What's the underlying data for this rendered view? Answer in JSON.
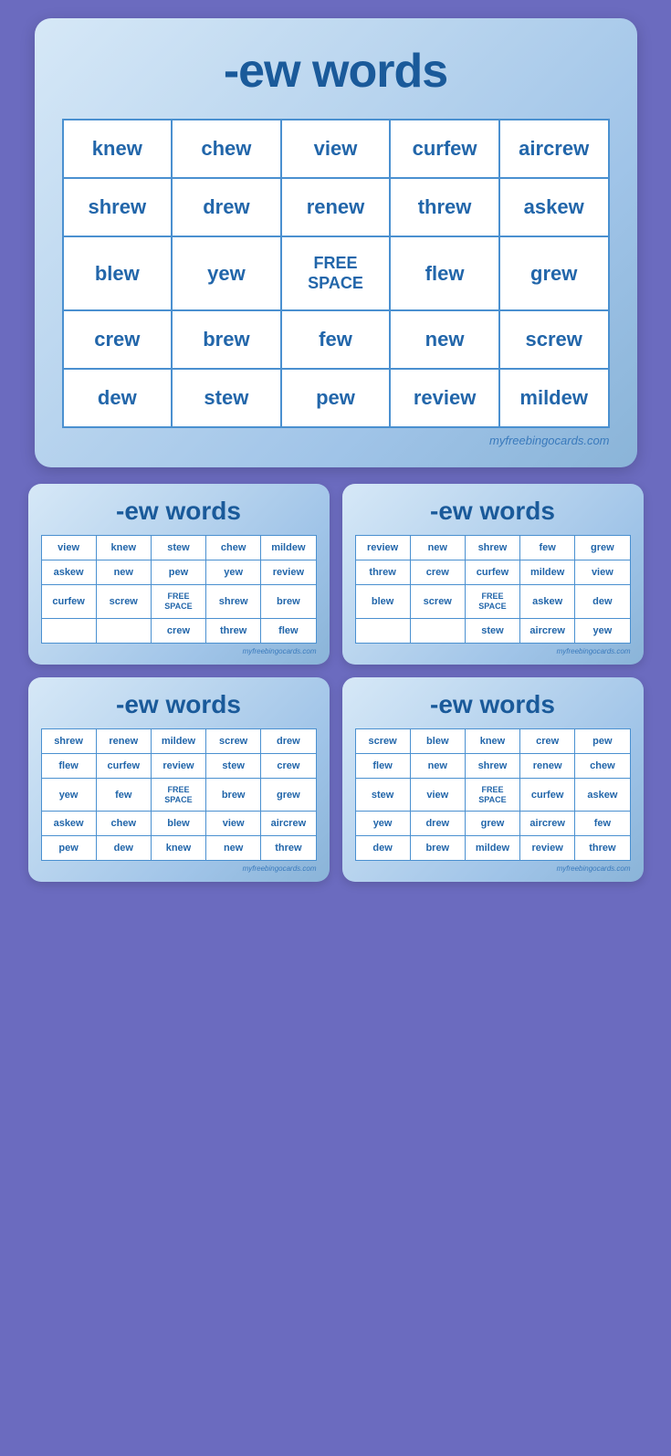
{
  "title": "-ew words",
  "watermark": "myfreebingocards.com",
  "mainCard": {
    "rows": [
      [
        "knew",
        "chew",
        "view",
        "curfew",
        "aircrew"
      ],
      [
        "shrew",
        "drew",
        "renew",
        "threw",
        "askew"
      ],
      [
        "blew",
        "yew",
        "FREE\nSPACE",
        "flew",
        "grew"
      ],
      [
        "crew",
        "brew",
        "few",
        "new",
        "screw"
      ],
      [
        "dew",
        "stew",
        "pew",
        "review",
        "mildew"
      ]
    ]
  },
  "smallCards": [
    {
      "title": "-ew words",
      "rows": [
        [
          "view",
          "knew",
          "stew",
          "chew",
          "mildew"
        ],
        [
          "askew",
          "new",
          "pew",
          "yew",
          "review"
        ],
        [
          "curfew",
          "screw",
          "FREE\nSPACE",
          "shrew",
          "brew"
        ],
        [
          "",
          "",
          "crew",
          "threw",
          "flew"
        ]
      ],
      "watermark": "myfreebingocards.com"
    },
    {
      "title": "-ew words",
      "rows": [
        [
          "review",
          "new",
          "shrew",
          "few",
          "grew"
        ],
        [
          "threw",
          "crew",
          "curfew",
          "mildew",
          "view"
        ],
        [
          "blew",
          "screw",
          "FREE\nSPACE",
          "askew",
          "dew"
        ],
        [
          "",
          "",
          "stew",
          "aircrew",
          "yew"
        ]
      ],
      "watermark": "myfreebingocards.com"
    },
    {
      "title": "-ew words",
      "rows": [
        [
          "shrew",
          "renew",
          "mildew",
          "screw",
          "drew"
        ],
        [
          "flew",
          "curfew",
          "review",
          "stew",
          "crew"
        ],
        [
          "yew",
          "few",
          "FREE\nSPACE",
          "brew",
          "grew"
        ],
        [
          "askew",
          "chew",
          "blew",
          "view",
          "aircrew"
        ],
        [
          "pew",
          "dew",
          "knew",
          "new",
          "threw"
        ]
      ],
      "watermark": "myfreebingocards.com"
    },
    {
      "title": "-ew words",
      "rows": [
        [
          "screw",
          "blew",
          "knew",
          "crew",
          "pew"
        ],
        [
          "flew",
          "new",
          "shrew",
          "renew",
          "chew"
        ],
        [
          "stew",
          "view",
          "FREE\nSPACE",
          "curfew",
          "askew"
        ],
        [
          "yew",
          "drew",
          "grew",
          "aircrew",
          "few"
        ],
        [
          "dew",
          "brew",
          "mildew",
          "review",
          "threw"
        ]
      ],
      "watermark": "myfreebingocards.com"
    }
  ]
}
